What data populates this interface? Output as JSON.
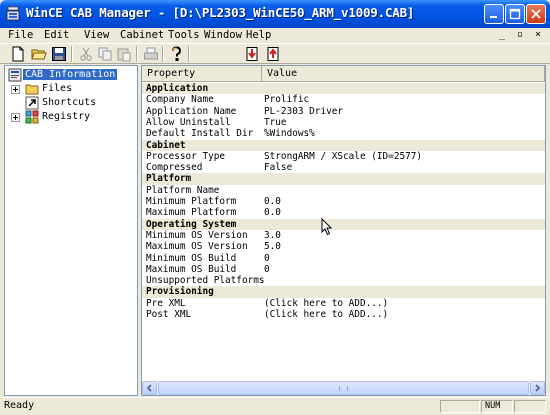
{
  "window": {
    "title": "WinCE CAB Manager - [D:\\PL2303_WinCE50_ARM_v1009.CAB]"
  },
  "menu": {
    "items": [
      "File",
      "Edit",
      "View",
      "Cabinet",
      "Tools",
      "Window",
      "Help"
    ],
    "mdi_controls": [
      "_",
      "▫",
      "×"
    ]
  },
  "toolbar": {
    "buttons": [
      "new-icon",
      "open-icon",
      "save-icon",
      "cut-icon",
      "copy-icon",
      "paste-icon",
      "print-icon",
      "help-icon",
      "import-icon",
      "export-icon"
    ]
  },
  "tree": {
    "items": [
      {
        "label": "CAB Information",
        "icon": "cab-info-icon",
        "selected": true
      },
      {
        "label": "Files",
        "icon": "folder-icon",
        "expandable": true
      },
      {
        "label": "Shortcuts",
        "icon": "shortcut-icon"
      },
      {
        "label": "Registry",
        "icon": "registry-icon",
        "expandable": true
      }
    ]
  },
  "properties": {
    "columns": [
      "Property",
      "Value"
    ],
    "rows": [
      {
        "section": "Application"
      },
      {
        "key": "Company Name",
        "value": "Prolific"
      },
      {
        "key": "Application Name",
        "value": "PL-2303 Driver"
      },
      {
        "key": "Allow Uninstall",
        "value": "True"
      },
      {
        "key": "Default Install Dir",
        "value": "%Windows%"
      },
      {
        "section": "Cabinet"
      },
      {
        "key": "Processor Type",
        "value": "StrongARM / XScale (ID=2577)"
      },
      {
        "key": "Compressed",
        "value": "False"
      },
      {
        "section": "Platform"
      },
      {
        "key": "Platform Name",
        "value": ""
      },
      {
        "key": "Minimum Platform",
        "value": "0.0"
      },
      {
        "key": "Maximum Platform",
        "value": "0.0"
      },
      {
        "section": "Operating System"
      },
      {
        "key": "Minimum OS Version",
        "value": "3.0"
      },
      {
        "key": "Maximum OS Version",
        "value": "5.0"
      },
      {
        "key": "Minimum OS Build",
        "value": "0"
      },
      {
        "key": "Maximum OS Build",
        "value": "0"
      },
      {
        "key": "Unsupported Platforms",
        "value": ""
      },
      {
        "section": "Provisioning"
      },
      {
        "key": "Pre XML",
        "value": "(Click here to ADD...)"
      },
      {
        "key": "Post XML",
        "value": "(Click here to ADD...)"
      }
    ]
  },
  "statusbar": {
    "text": "Ready",
    "panels": [
      "",
      "NUM",
      ""
    ]
  }
}
